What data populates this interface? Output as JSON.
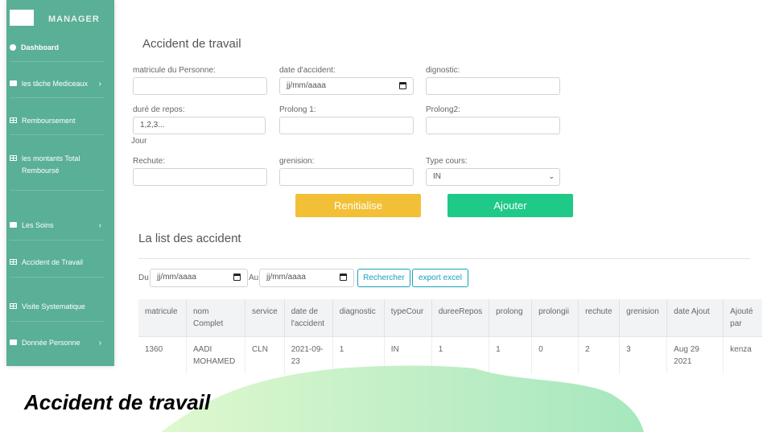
{
  "sidebar": {
    "brand": "MANAGER",
    "items": [
      {
        "label": "Dashboard",
        "icon": "dashboard-icon"
      },
      {
        "label": "les tâche Mediceaux",
        "icon": "folder-icon",
        "chevron": "›"
      },
      {
        "label": "Remboursement",
        "icon": "table-icon"
      },
      {
        "label": "les montants Total Remboursé",
        "icon": "table-icon"
      },
      {
        "label": "Les Soins",
        "icon": "folder-icon",
        "chevron": "›"
      },
      {
        "label": "Accident de Travail",
        "icon": "table-icon"
      },
      {
        "label": "Visite Systematique",
        "icon": "table-icon"
      },
      {
        "label": "Donnée Personne",
        "icon": "folder-icon",
        "chevron": "›"
      }
    ]
  },
  "form": {
    "title": "Accident de travail",
    "fields": {
      "matricule": {
        "label": "matricule du Personne:",
        "value": ""
      },
      "date_accident": {
        "label": "date d'accident:",
        "placeholder": "jj/mm/aaaa"
      },
      "diagnostic": {
        "label": "dignostic:",
        "value": ""
      },
      "repos": {
        "label": "duré de repos:",
        "placeholder": "1,2,3...",
        "suffix": "Jour"
      },
      "prolong1": {
        "label": "Prolong 1:",
        "value": ""
      },
      "prolong2": {
        "label": "Prolong2:",
        "value": ""
      },
      "rechute": {
        "label": "Rechute:",
        "value": ""
      },
      "grenision": {
        "label": "grenision:",
        "value": ""
      },
      "type_cours": {
        "label": "Type cours:",
        "value": "IN"
      }
    },
    "reset_label": "Renitialise",
    "add_label": "Ajouter",
    "colors": {
      "reset": "#f2c037",
      "add": "#1fc987"
    }
  },
  "list": {
    "title": "La list des accident",
    "du_label": "Du",
    "au_label": "Au",
    "date_placeholder": "jj/mm/aaaa",
    "search_label": "Rechercher",
    "export_label": "export excel",
    "headers": [
      "matricule",
      "nom Complet",
      "service",
      "date de l'accident",
      "diagnostic",
      "typeCour",
      "dureeRepos",
      "prolong",
      "prolongii",
      "rechute",
      "grenision",
      "date Ajout",
      "Ajouté par"
    ],
    "rows": [
      [
        "1360",
        "AADI MOHAMED",
        "CLN",
        "2021-09-23",
        "1",
        "IN",
        "1",
        "1",
        "0",
        "2",
        "3",
        "Aug 29 2021",
        "kenza"
      ]
    ]
  },
  "caption": "Accident de travail"
}
